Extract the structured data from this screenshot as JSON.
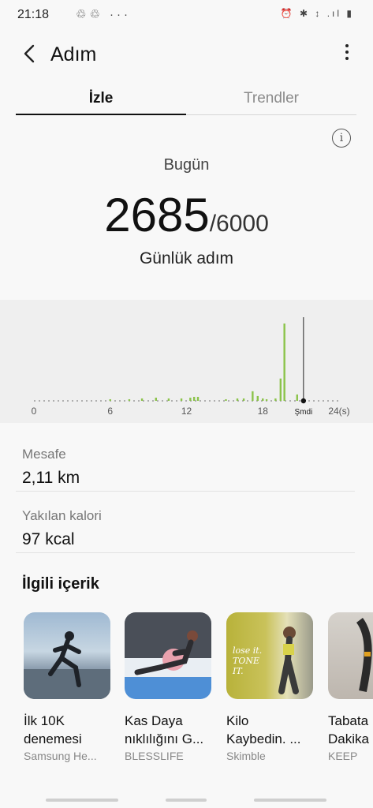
{
  "status_bar": {
    "time": "21:18",
    "left_icons": "♲♲ ···",
    "right_icons": "⏰ ✱ ↕ .ıl ▮"
  },
  "header": {
    "title": "Adım"
  },
  "tabs": [
    {
      "label": "İzle",
      "active": true
    },
    {
      "label": "Trendler",
      "active": false
    }
  ],
  "summary": {
    "period": "Bugün",
    "steps": "2685",
    "goal": "/6000",
    "unit_label": "Günlük adım"
  },
  "chart_data": {
    "type": "bar",
    "x_ticks": [
      "0",
      "6",
      "12",
      "18",
      "Şmdi",
      "24(s)"
    ],
    "now_hour": 21.2,
    "xlim": [
      0,
      24
    ],
    "series": [
      {
        "values": [
          {
            "h": 6.0,
            "v": 2
          },
          {
            "h": 7.5,
            "v": 2
          },
          {
            "h": 8.5,
            "v": 3
          },
          {
            "h": 9.6,
            "v": 4
          },
          {
            "h": 10.6,
            "v": 3
          },
          {
            "h": 11.6,
            "v": 3
          },
          {
            "h": 12.3,
            "v": 4
          },
          {
            "h": 12.6,
            "v": 5
          },
          {
            "h": 12.9,
            "v": 5
          },
          {
            "h": 15.1,
            "v": 2
          },
          {
            "h": 16.0,
            "v": 3
          },
          {
            "h": 16.5,
            "v": 3
          },
          {
            "h": 17.2,
            "v": 12
          },
          {
            "h": 17.6,
            "v": 6
          },
          {
            "h": 18.0,
            "v": 3
          },
          {
            "h": 18.3,
            "v": 2
          },
          {
            "h": 19.0,
            "v": 3
          },
          {
            "h": 19.4,
            "v": 28
          },
          {
            "h": 19.7,
            "v": 97
          },
          {
            "h": 20.7,
            "v": 8
          }
        ]
      }
    ],
    "bar_color": "#8bc34a",
    "grid": false
  },
  "stats": [
    {
      "label": "Mesafe",
      "value": "2,11 km"
    },
    {
      "label": "Yakılan kalori",
      "value": "97 kcal"
    }
  ],
  "related": {
    "heading": "İlgili içerik",
    "cards": [
      {
        "title1": "İlk 10K",
        "title2": "denemesi",
        "source": "Samsung He..."
      },
      {
        "title1": "Kas Daya",
        "title2": "nıklılığını G...",
        "source": "BLESSLIFE"
      },
      {
        "title1": "Kilo",
        "title2": "Kaybedin. ...",
        "source": "Skimble",
        "thumb_text": "lose it. TONE IT."
      },
      {
        "title1": "Tabata",
        "title2": "Dakika",
        "source": "KEEP"
      }
    ]
  },
  "colors": {
    "accent_green": "#8bc34a",
    "tab_active": "#111111",
    "tab_inactive_line": "#d6d6d6"
  }
}
